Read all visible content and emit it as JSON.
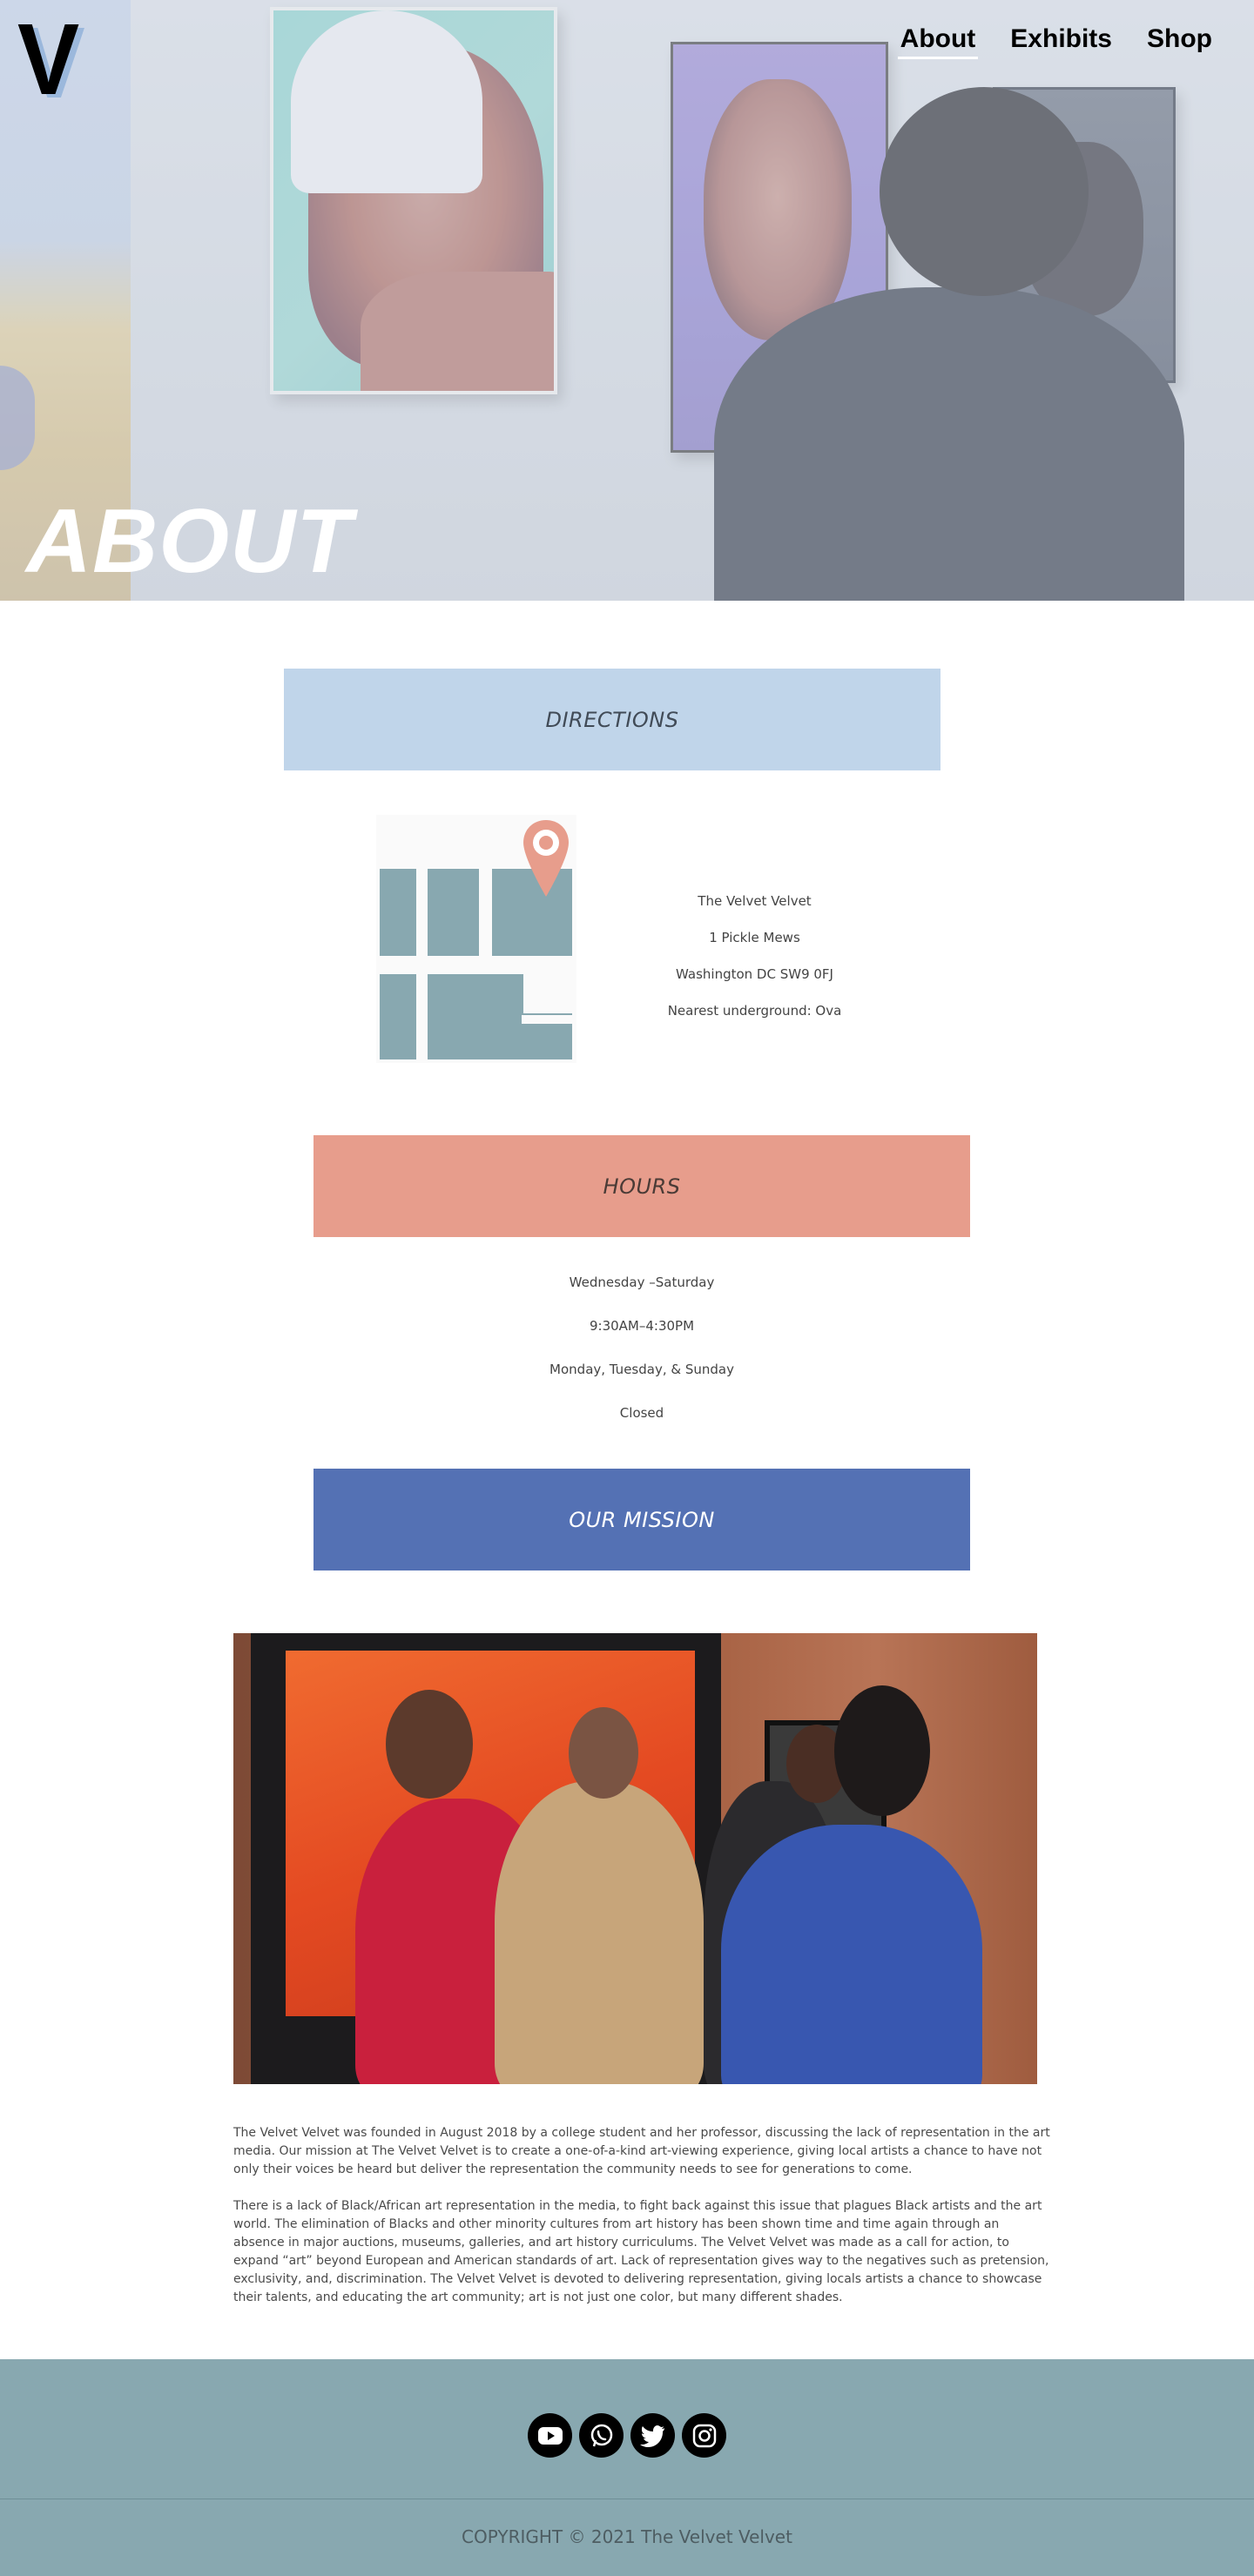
{
  "header": {
    "logo_letter": "V",
    "nav": [
      {
        "label": "About",
        "active": true
      },
      {
        "label": "Exhibits",
        "active": false
      },
      {
        "label": "Shop",
        "active": false
      }
    ]
  },
  "hero": {
    "title": "ABOUT"
  },
  "directions": {
    "heading": "DIRECTIONS",
    "address": [
      "The Velvet Velvet",
      "1 Pickle Mews",
      "Washington DC SW9 0FJ",
      "Nearest underground: Ova"
    ]
  },
  "hours": {
    "heading": "HOURS",
    "lines": [
      "Wednesday –Saturday",
      "9:30AM–4:30PM",
      "Monday, Tuesday, & Sunday",
      "Closed"
    ]
  },
  "mission": {
    "heading": "OUR MISSION",
    "paragraphs": [
      "The Velvet Velvet was founded in August 2018 by a college student and her professor, discussing the lack of representation in the art media. Our mission at The Velvet Velvet is to create a one-of-a-kind art-viewing experience, giving local artists a chance to have not only their voices be heard but deliver the representation the community needs to see for generations to come.",
      "There is a lack of Black/African art representation in the media, to fight back against this issue that plagues Black artists and the art world. The elimination of Blacks and other minority cultures from art history has been shown time and time again through an absence in major auctions, museums, galleries, and art history curriculums. The Velvet Velvet was made as a call for action, to expand “art” beyond European and American standards of art. Lack of representation gives way to the negatives such as pretension, exclusivity, and, discrimination. The Velvet Velvet is devoted to delivering representation, giving locals artists a chance to showcase their talents, and educating the art community; art is not just one color, but many different shades."
    ]
  },
  "footer": {
    "socials": [
      "youtube-icon",
      "whatsapp-icon",
      "twitter-icon",
      "instagram-icon"
    ],
    "copyright": "COPYRIGHT © 2021 The Velvet Velvet"
  },
  "colors": {
    "directions_band": "#c0d5ea",
    "hours_band": "#e79d8c",
    "mission_band": "#5471b4",
    "footer": "#88a8b0",
    "map_blocks": "#88a8b0",
    "map_pin": "#e79d8c"
  }
}
